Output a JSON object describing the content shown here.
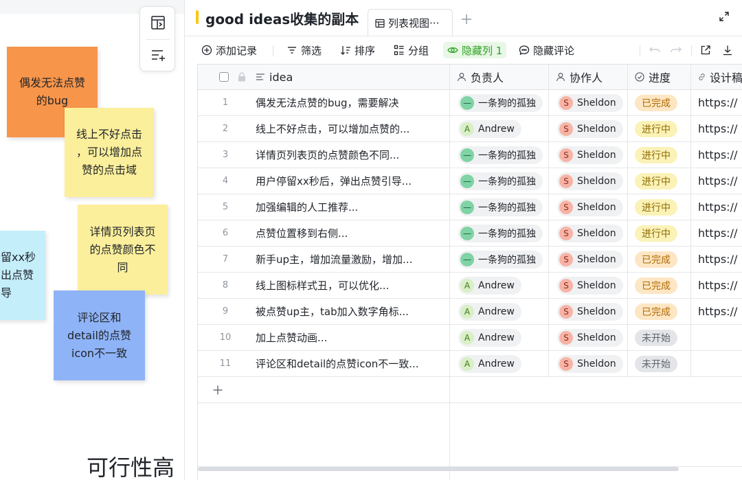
{
  "board": {
    "stickies": [
      {
        "text": "偶发无法点赞\n的bug",
        "color": "#f7954a"
      },
      {
        "text": "线上不好点击\n，可以增加点\n赞的点击域",
        "color": "#fcef9b"
      },
      {
        "text": "详情页列表页\n的点赞颜色不\n同",
        "color": "#fcef9b"
      },
      {
        "text": "留xx秒\n出点赞\n导",
        "color": "#c4eefa"
      },
      {
        "text": "评论区和\ndetail的点赞\nicon不一致",
        "color": "#8fb3f7"
      }
    ],
    "big_title": "可行性高"
  },
  "header": {
    "doc_title": "good ideas收集的副本",
    "view_tab": "列表视图···",
    "accent_color": "#ffc60a"
  },
  "toolbar": {
    "add_record": "添加记录",
    "filter": "筛选",
    "sort": "排序",
    "group": "分组",
    "hidden_columns": "隐藏列 1",
    "hide_comments": "隐藏评论"
  },
  "columns": {
    "idea": "idea",
    "owner": "负责人",
    "collaborator": "协作人",
    "progress": "进度",
    "design": "设计稿"
  },
  "rows": [
    {
      "idx": "1",
      "idea": "偶发无法点赞的bug，需要解决",
      "owner": "一条狗的孤独",
      "owner_avatar": "—",
      "owner_type": "dog",
      "collab": "Sheldon",
      "collab_avatar": "S",
      "status": "已完成",
      "status_type": "done",
      "link": "https://"
    },
    {
      "idx": "2",
      "idea": "线上不好点击，可以增加点赞的...",
      "owner": "Andrew",
      "owner_avatar": "A",
      "owner_type": "andrew",
      "collab": "Sheldon",
      "collab_avatar": "S",
      "status": "进行中",
      "status_type": "doing",
      "link": "https://"
    },
    {
      "idx": "3",
      "idea": "详情页列表页的点赞颜色不同...",
      "owner": "一条狗的孤独",
      "owner_avatar": "—",
      "owner_type": "dog",
      "collab": "Sheldon",
      "collab_avatar": "S",
      "status": "进行中",
      "status_type": "doing",
      "link": "https://"
    },
    {
      "idx": "4",
      "idea": "用户停留xx秒后，弹出点赞引导...",
      "owner": "一条狗的孤独",
      "owner_avatar": "—",
      "owner_type": "dog",
      "collab": "Sheldon",
      "collab_avatar": "S",
      "status": "进行中",
      "status_type": "doing",
      "link": "https://"
    },
    {
      "idx": "5",
      "idea": "加强编辑的人工推荐...",
      "owner": "一条狗的孤独",
      "owner_avatar": "—",
      "owner_type": "dog",
      "collab": "Sheldon",
      "collab_avatar": "S",
      "status": "进行中",
      "status_type": "doing",
      "link": "https://"
    },
    {
      "idx": "6",
      "idea": "点赞位置移到右侧...",
      "owner": "一条狗的孤独",
      "owner_avatar": "—",
      "owner_type": "dog",
      "collab": "Sheldon",
      "collab_avatar": "S",
      "status": "进行中",
      "status_type": "doing",
      "link": "https://"
    },
    {
      "idx": "7",
      "idea": "新手up主，增加流量激励，增加...",
      "owner": "一条狗的孤独",
      "owner_avatar": "—",
      "owner_type": "dog",
      "collab": "Sheldon",
      "collab_avatar": "S",
      "status": "已完成",
      "status_type": "done",
      "link": "https://"
    },
    {
      "idx": "8",
      "idea": "线上图标样式丑，可以优化...",
      "owner": "Andrew",
      "owner_avatar": "A",
      "owner_type": "andrew",
      "collab": "Sheldon",
      "collab_avatar": "S",
      "status": "已完成",
      "status_type": "done",
      "link": "https://"
    },
    {
      "idx": "9",
      "idea": "被点赞up主，tab加入数字角标...",
      "owner": "Andrew",
      "owner_avatar": "A",
      "owner_type": "andrew",
      "collab": "Sheldon",
      "collab_avatar": "S",
      "status": "已完成",
      "status_type": "done",
      "link": "https://"
    },
    {
      "idx": "10",
      "idea": "加上点赞动画...",
      "owner": "Andrew",
      "owner_avatar": "A",
      "owner_type": "andrew",
      "collab": "Sheldon",
      "collab_avatar": "S",
      "status": "未开始",
      "status_type": "todo",
      "link": ""
    },
    {
      "idx": "11",
      "idea": "评论区和detail的点赞icon不一致...",
      "owner": "Andrew",
      "owner_avatar": "A",
      "owner_type": "andrew",
      "collab": "Sheldon",
      "collab_avatar": "S",
      "status": "未开始",
      "status_type": "todo",
      "link": ""
    }
  ]
}
